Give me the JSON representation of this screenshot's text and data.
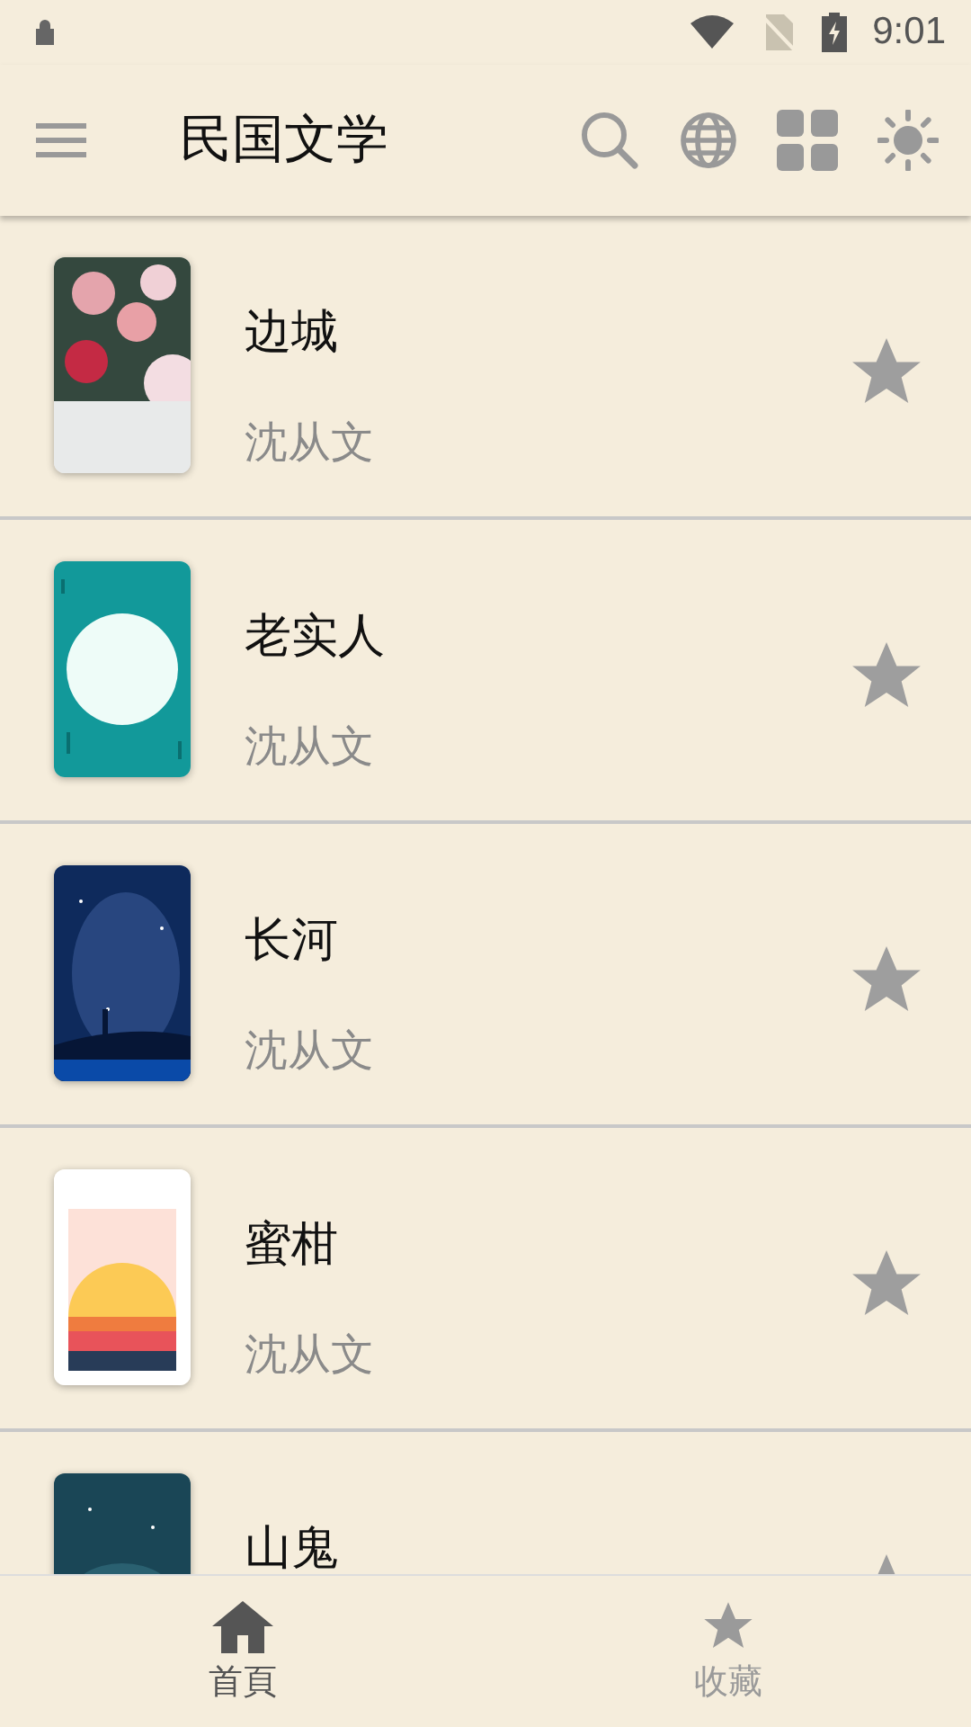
{
  "status_bar": {
    "time": "9:01"
  },
  "app_bar": {
    "title": "民国文学"
  },
  "books": [
    {
      "title": "边城",
      "author": "沈从文",
      "starred": false
    },
    {
      "title": "老实人",
      "author": "沈从文",
      "starred": false
    },
    {
      "title": "长河",
      "author": "沈从文",
      "starred": false
    },
    {
      "title": "蜜柑",
      "author": "沈从文",
      "starred": false
    },
    {
      "title": "山鬼",
      "starred": false
    }
  ],
  "bottom_nav": [
    {
      "label": "首頁",
      "selected": true
    },
    {
      "label": "收藏",
      "selected": false
    }
  ]
}
